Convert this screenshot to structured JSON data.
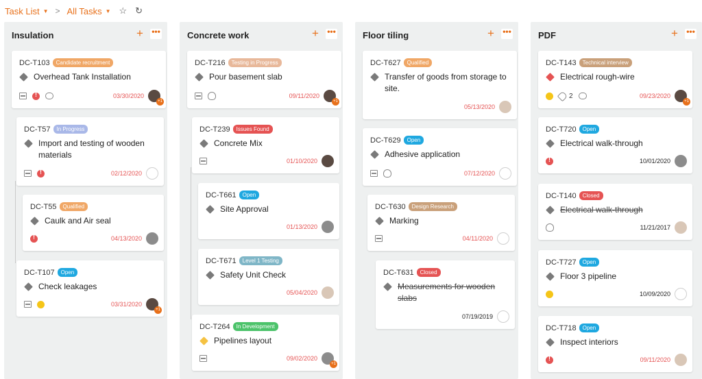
{
  "topbar": {
    "task_list_label": "Task List",
    "all_tasks_label": "All Tasks",
    "separator": ">",
    "star_icon": "star-icon",
    "refresh_icon": "refresh-icon"
  },
  "columns": [
    {
      "title": "Insulation",
      "cards": [
        {
          "id": "DC-T103",
          "badge": "Candidate recruitment",
          "badge_color": "#f0a766",
          "title": "Overhead Tank Installation",
          "date": "03/30/2020",
          "date_color": "red"
        },
        {
          "id": "DC-T57",
          "badge": "In Progress",
          "badge_color": "#a9b8e8",
          "title": "Import and testing of wooden materials",
          "date": "02/12/2020",
          "date_color": "red"
        },
        {
          "id": "DC-T55",
          "badge": "Qualified",
          "badge_color": "#f0a766",
          "title": "Caulk and Air seal",
          "date": "04/13/2020",
          "date_color": "red"
        },
        {
          "id": "DC-T107",
          "badge": "Open",
          "badge_color": "#1fa8e0",
          "title": "Check leakages",
          "date": "03/31/2020",
          "date_color": "red"
        }
      ]
    },
    {
      "title": "Concrete work",
      "cards": [
        {
          "id": "DC-T216",
          "badge": "Testing in Progress",
          "badge_color": "#e8b89a",
          "title": "Pour basement slab",
          "date": "09/11/2020",
          "date_color": "red"
        },
        {
          "id": "DC-T239",
          "badge": "Issues Found",
          "badge_color": "#e55353",
          "title": "Concrete Mix",
          "date": "01/10/2020",
          "date_color": "red"
        },
        {
          "id": "DC-T661",
          "badge": "Open",
          "badge_color": "#1fa8e0",
          "title": "Site Approval",
          "date": "01/13/2020",
          "date_color": "red"
        },
        {
          "id": "DC-T671",
          "badge": "Level 1 Testing",
          "badge_color": "#7fb6c7",
          "title": "Safety Unit Check",
          "date": "05/04/2020",
          "date_color": "red"
        },
        {
          "id": "DC-T264",
          "badge": "In Development",
          "badge_color": "#4cc36a",
          "title": "Pipelines layout",
          "date": "09/02/2020",
          "date_color": "red"
        }
      ]
    },
    {
      "title": "Floor tiling",
      "cards": [
        {
          "id": "DC-T627",
          "badge": "Qualified",
          "badge_color": "#f0a766",
          "title": "Transfer of goods from storage to site.",
          "date": "05/13/2020",
          "date_color": "red"
        },
        {
          "id": "DC-T629",
          "badge": "Open",
          "badge_color": "#1fa8e0",
          "title": "Adhesive application",
          "date": "07/12/2020",
          "date_color": "red"
        },
        {
          "id": "DC-T630",
          "badge": "Design Research",
          "badge_color": "#c9a07a",
          "title": "Marking",
          "date": "04/11/2020",
          "date_color": "red"
        },
        {
          "id": "DC-T631",
          "badge": "Closed",
          "badge_color": "#e55353",
          "title": "Measurements for wooden slabs",
          "date": "07/19/2019",
          "date_color": "black"
        }
      ]
    },
    {
      "title": "PDF",
      "cards": [
        {
          "id": "DC-T143",
          "badge": "Technical interview",
          "badge_color": "#c9a07a",
          "title": "Electrical rough-wire",
          "tag_count": "2",
          "date": "09/23/2020",
          "date_color": "red"
        },
        {
          "id": "DC-T720",
          "badge": "Open",
          "badge_color": "#1fa8e0",
          "title": "Electrical walk-through",
          "date": "10/01/2020",
          "date_color": "black"
        },
        {
          "id": "DC-T140",
          "badge": "Closed",
          "badge_color": "#e55353",
          "title": "Electrical walk-through",
          "date": "11/21/2017",
          "date_color": "black"
        },
        {
          "id": "DC-T727",
          "badge": "Open",
          "badge_color": "#1fa8e0",
          "title": "Floor 3 pipeline",
          "date": "10/09/2020",
          "date_color": "black"
        },
        {
          "id": "DC-T718",
          "badge": "Open",
          "badge_color": "#1fa8e0",
          "title": "Inspect interiors",
          "date": "09/11/2020",
          "date_color": "red"
        }
      ]
    }
  ],
  "ui": {
    "add_symbol": "+",
    "more_symbol": "•••",
    "avatar_plus": "+1"
  }
}
